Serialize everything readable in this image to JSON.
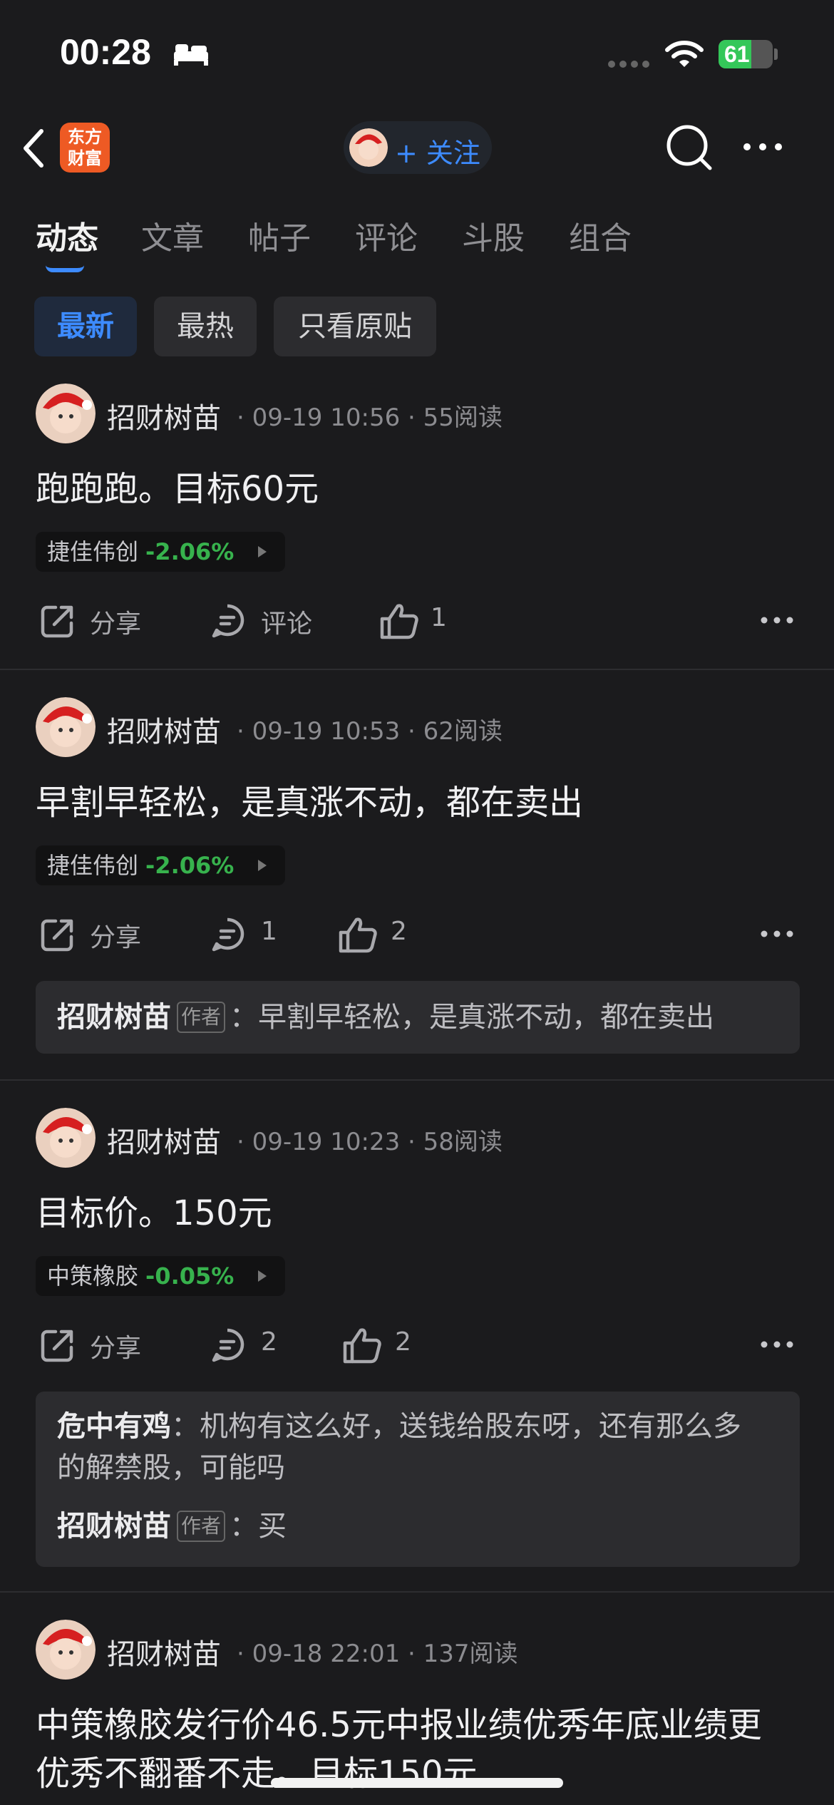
{
  "status_bar": {
    "time": "00:28",
    "battery": "61",
    "battery_level": 0.61
  },
  "nav": {
    "logo_line1": "东方",
    "logo_line2": "财富",
    "follow_label": "+ 关注"
  },
  "tabs": [
    "动态",
    "文章",
    "帖子",
    "评论",
    "斗股",
    "组合"
  ],
  "active_tab": "动态",
  "filters": [
    "最新",
    "最热",
    "只看原贴"
  ],
  "posts": [
    {
      "user": "招财树苗",
      "meta": "· 09-19 10:56 · 55阅读",
      "text": "跑跑跑。目标60元",
      "stock": {
        "name": "捷佳伟创",
        "change": "-2.06%"
      },
      "share": "分享",
      "comment": "评论",
      "like": "1"
    },
    {
      "user": "招财树苗",
      "meta": "· 09-19 10:53 · 62阅读",
      "text": "早割早轻松，是真涨不动，都在卖出",
      "stock": {
        "name": "捷佳伟创",
        "change": "-2.06%"
      },
      "share": "分享",
      "comment": "1",
      "like": "2",
      "comments": [
        {
          "author": "招财树苗",
          "tag": "作者",
          "text": "早割早轻松，是真涨不动，都在卖出"
        }
      ]
    },
    {
      "user": "招财树苗",
      "meta": "· 09-19 10:23 · 58阅读",
      "text": "目标价。150元",
      "stock": {
        "name": "中策橡胶",
        "change": "-0.05%"
      },
      "share": "分享",
      "comment": "2",
      "like": "2",
      "comments": [
        {
          "author": "危中有鸡",
          "text_line1": "机构有这么好，送钱给股东呀，还有那么多",
          "text_line2": "的解禁股，可能吗"
        },
        {
          "author": "招财树苗",
          "tag": "作者",
          "text": "买"
        }
      ]
    },
    {
      "user": "招财树苗",
      "meta": "· 09-18 22:01 · 137阅读",
      "text_line1": "中策橡胶发行价46.5元中报业绩优秀年底业绩更",
      "text_line2": "优秀不翻番不走。目标150元"
    }
  ],
  "colors": {
    "accent": "#3d8bff",
    "down": "#37b24d",
    "background": "#1b1b1d"
  }
}
